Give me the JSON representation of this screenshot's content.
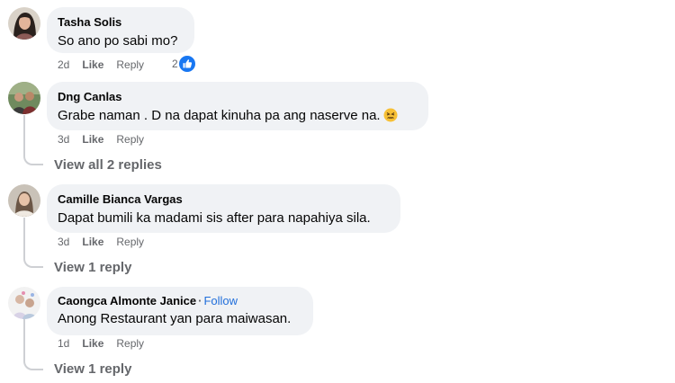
{
  "comments": [
    {
      "author": "Tasha Solis",
      "text": "So ano po sabi mo?",
      "time": "2d",
      "like_label": "Like",
      "reply_label": "Reply",
      "reaction_count": "2",
      "reaction_icon": "like-reaction-icon"
    },
    {
      "author": "Dng Canlas",
      "text": "Grabe naman . D na dapat kinuha pa ang naserve na.",
      "emoji": "confounded-face-emoji",
      "time": "3d",
      "like_label": "Like",
      "reply_label": "Reply",
      "view_replies": "View all 2 replies"
    },
    {
      "author": "Camille Bianca Vargas",
      "text": "Dapat bumili ka madami sis after para napahiya sila.",
      "time": "3d",
      "like_label": "Like",
      "reply_label": "Reply",
      "view_replies": "View 1 reply"
    },
    {
      "author": "Caongca Almonte Janice",
      "separator": "·",
      "follow_label": "Follow",
      "text": "Anong Restaurant yan para maiwasan.",
      "time": "1d",
      "like_label": "Like",
      "reply_label": "Reply",
      "view_replies": "View 1 reply"
    }
  ],
  "colors": {
    "bubble": "#f0f2f5",
    "meta_text": "#65676b",
    "follow_link": "#216fdb",
    "like_reaction": "#1877f2"
  }
}
